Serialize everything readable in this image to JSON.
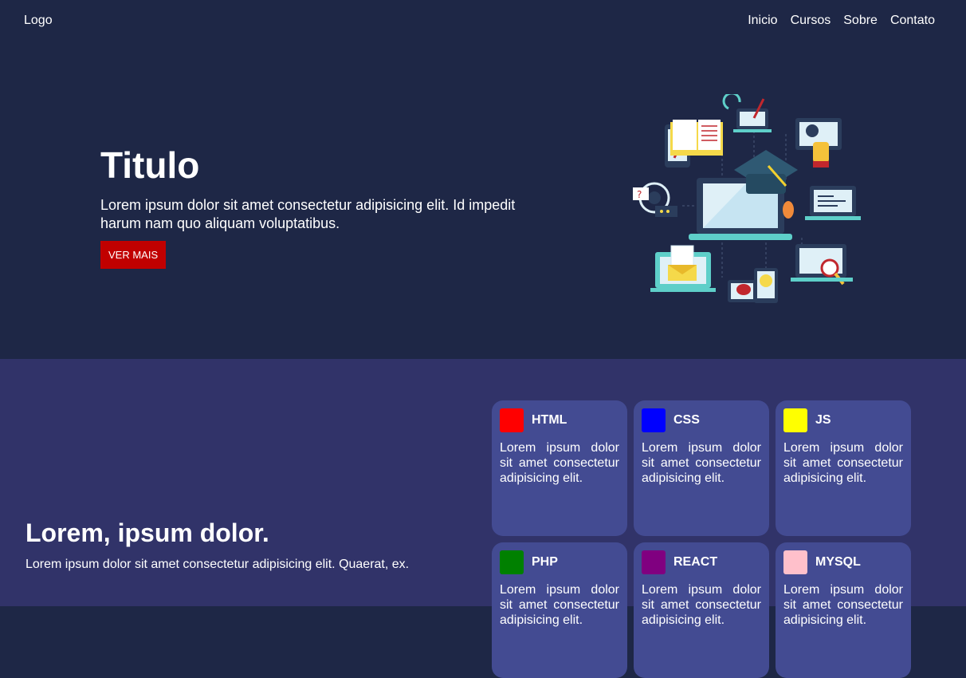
{
  "navbar": {
    "logo": "Logo",
    "links": [
      "Inicio",
      "Cursos",
      "Sobre",
      "Contato"
    ]
  },
  "hero": {
    "title": "Titulo",
    "description": "Lorem ipsum dolor sit amet consectetur adipisicing elit. Id impedit harum nam quo aliquam voluptatibus.",
    "button": "VER MAIS"
  },
  "section": {
    "title": "Lorem, ipsum dolor.",
    "description": "Lorem ipsum dolor sit amet consectetur adipisicing elit. Quaerat, ex."
  },
  "cards": [
    {
      "title": "HTML",
      "color": "#ff0000",
      "text": "Lorem ipsum dolor sit amet consectetur adipisicing elit."
    },
    {
      "title": "CSS",
      "color": "#0000ff",
      "text": "Lorem ipsum dolor sit amet consectetur adipisicing elit."
    },
    {
      "title": "JS",
      "color": "#ffff00",
      "text": "Lorem ipsum dolor sit amet consectetur adipisicing elit."
    },
    {
      "title": "PHP",
      "color": "#008000",
      "text": "Lorem ipsum dolor sit amet consectetur adipisicing elit."
    },
    {
      "title": "REACT",
      "color": "#800080",
      "text": "Lorem ipsum dolor sit amet consectetur adipisicing elit."
    },
    {
      "title": "MYSQL",
      "color": "#ffc0cb",
      "text": "Lorem ipsum dolor sit amet consectetur adipisicing elit."
    }
  ],
  "colors": {
    "header_bg": "#1e2746",
    "section_bg": "#313369",
    "card_bg": "#434b92",
    "button_bg": "#c10000"
  },
  "illustration": "e-learning-illustration"
}
